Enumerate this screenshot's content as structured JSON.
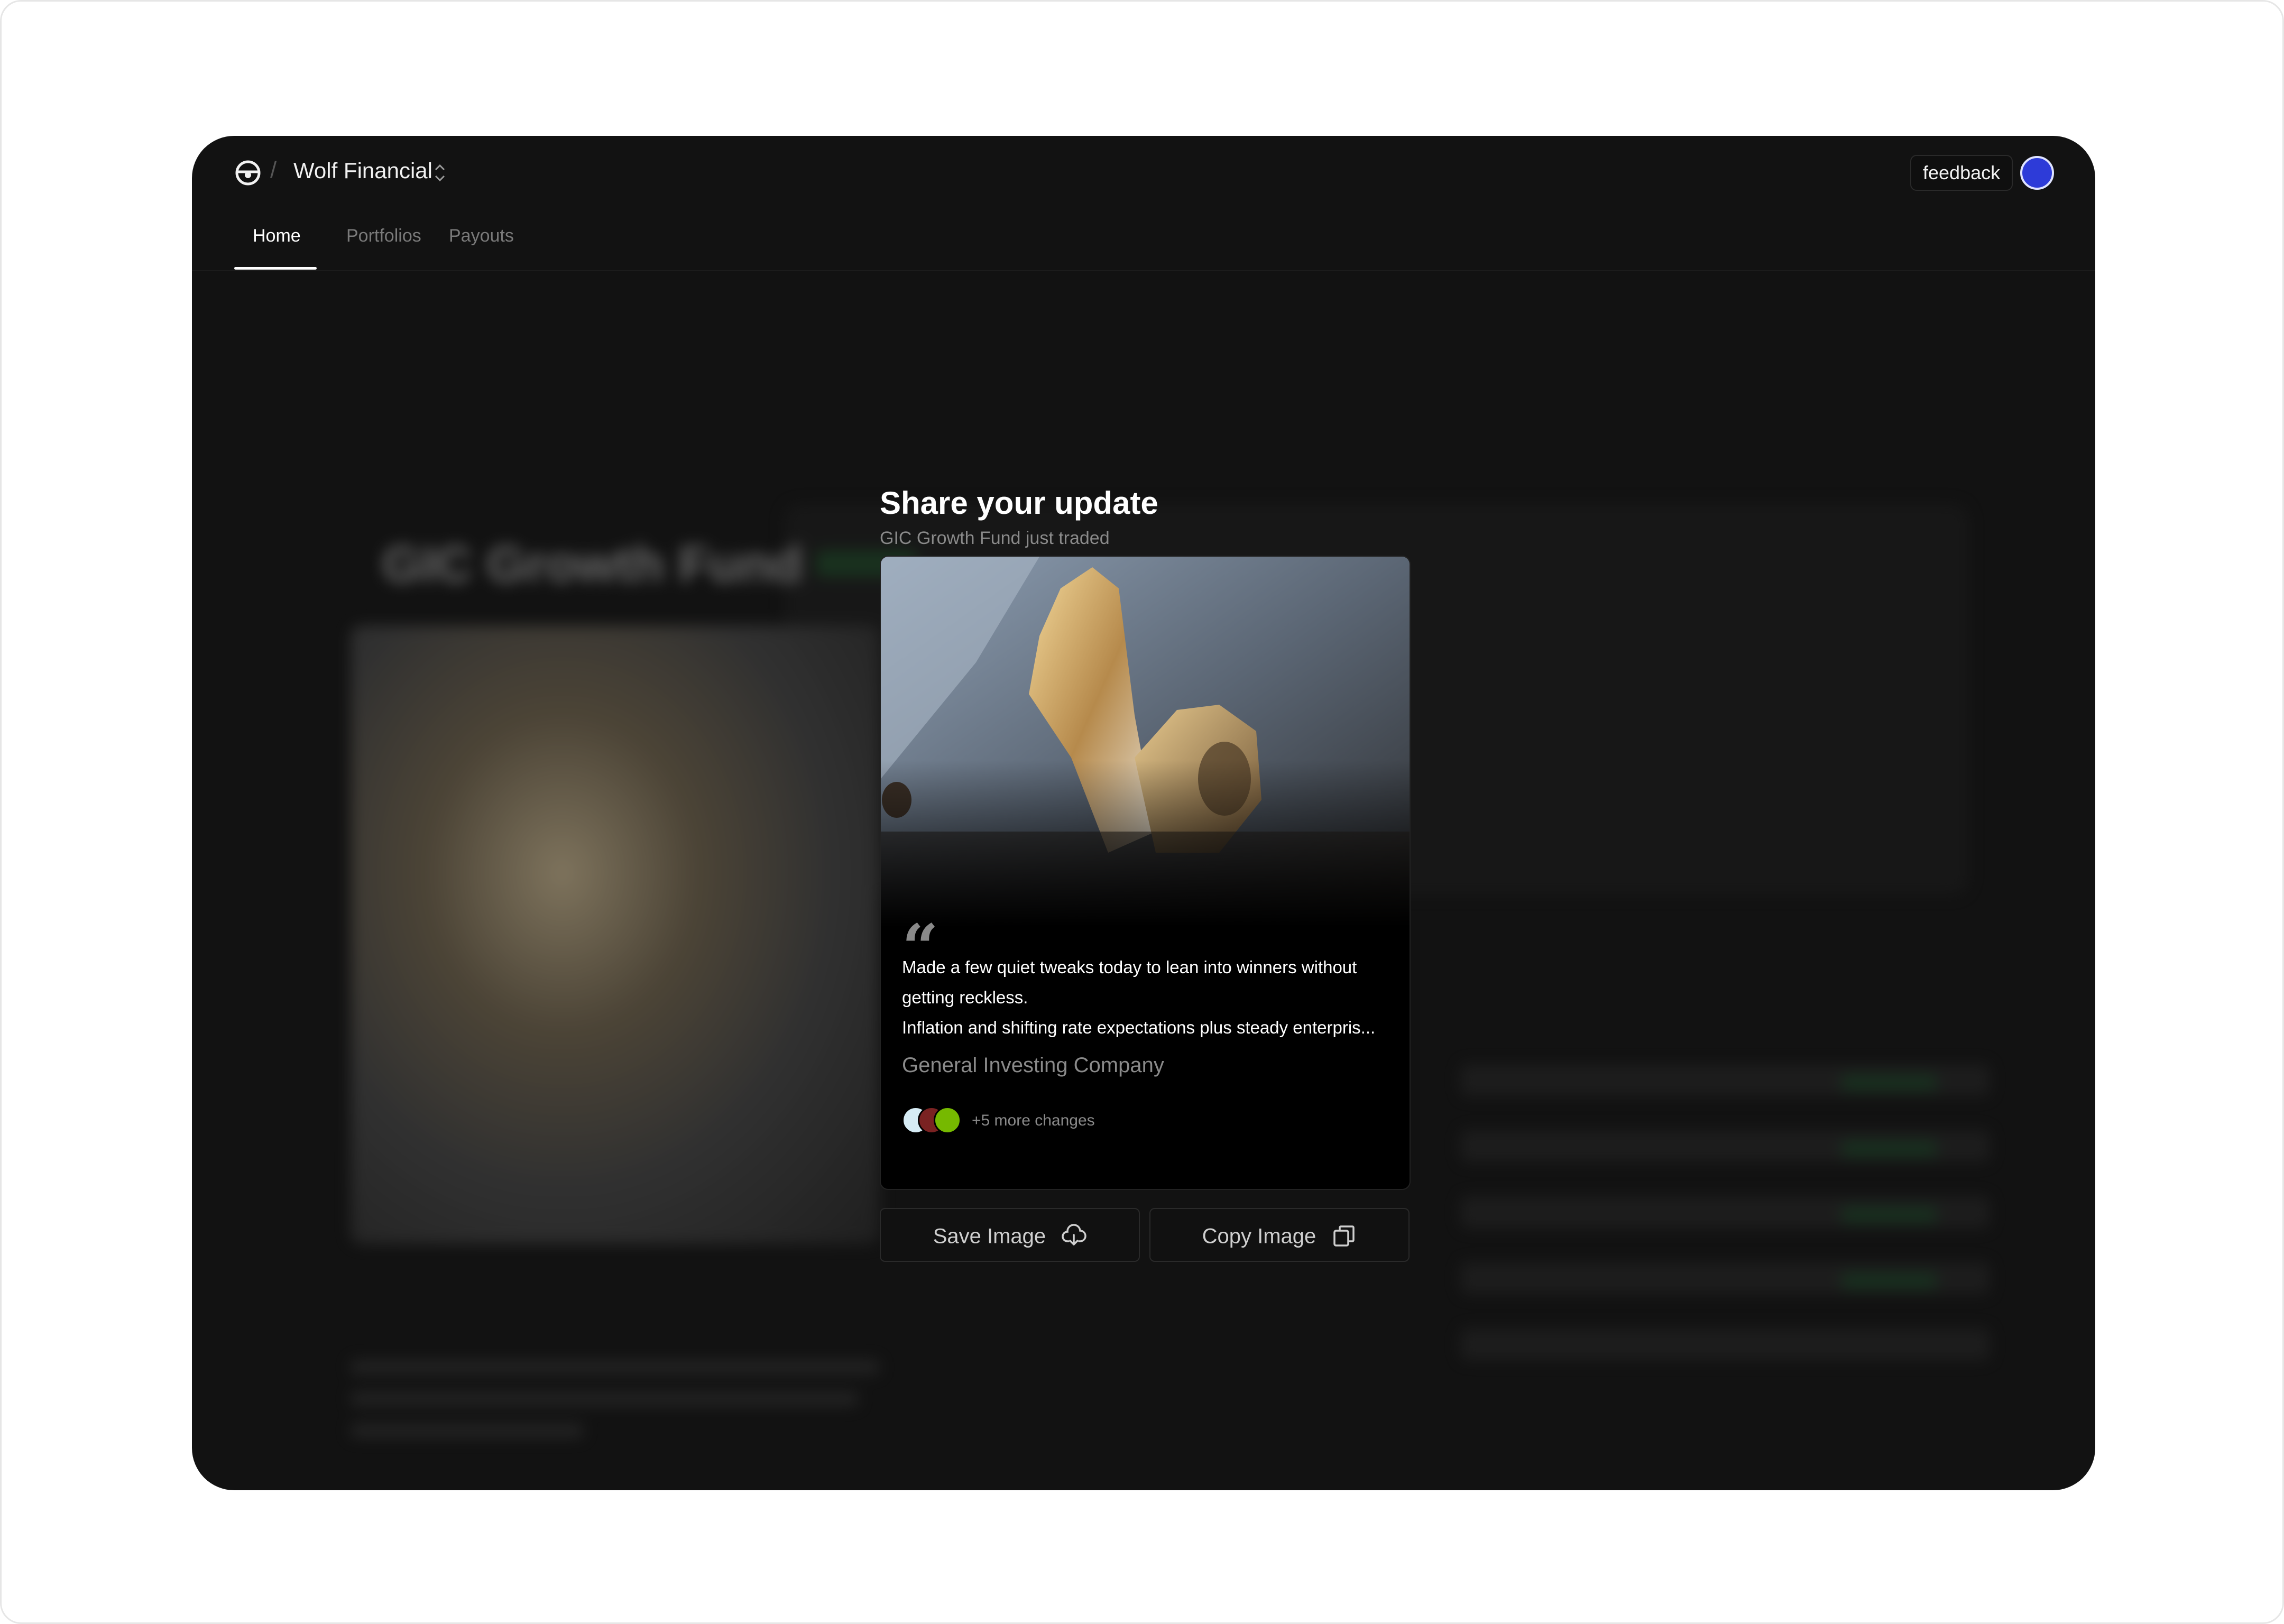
{
  "header": {
    "workspace_name": "Wolf Financial",
    "feedback_label": "feedback"
  },
  "tabs": [
    {
      "label": "Home",
      "active": true
    },
    {
      "label": "Portfolios",
      "active": false
    },
    {
      "label": "Payouts",
      "active": false
    }
  ],
  "background": {
    "fund_title": "GIC Growth Fund"
  },
  "modal": {
    "title": "Share your update",
    "subtitle": "GIC Growth Fund just traded",
    "card": {
      "quote_lines": [
        "Made a few quiet tweaks today to lean into winners without",
        "getting reckless.",
        "Inflation and shifting rate expectations plus steady enterpris..."
      ],
      "company": "General Investing Company",
      "more_changes": "+5 more changes"
    },
    "save_label": "Save Image",
    "copy_label": "Copy Image"
  },
  "colors": {
    "app_bg": "#121212",
    "accent_avatar": "#2d3bd8",
    "positive_green": "#1d4a2a"
  },
  "icons": {
    "logo": "steering-wheel-icon",
    "workspace_switch": "chevron-up-down-icon",
    "save": "cloud-download-icon",
    "copy": "copy-icon",
    "quote": "quote-icon"
  }
}
